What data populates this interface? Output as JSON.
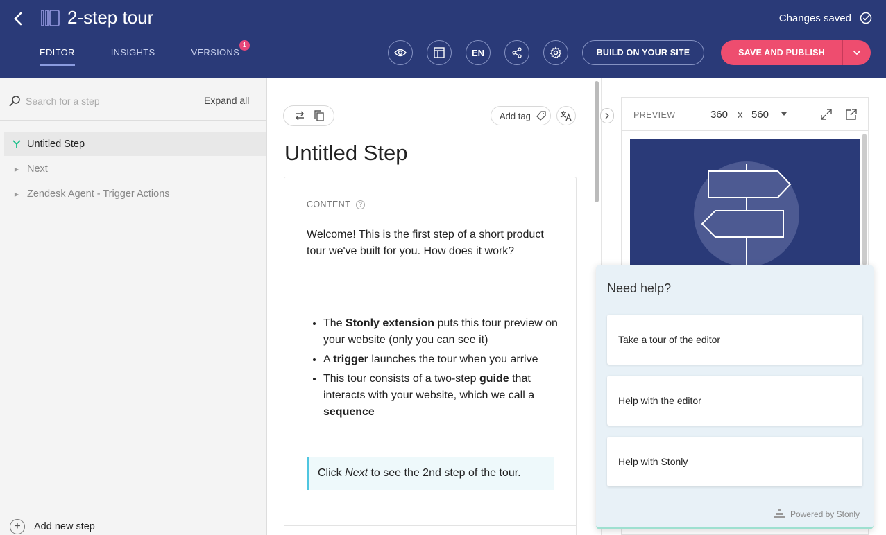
{
  "header": {
    "title": "2-step tour",
    "status": "Changes saved",
    "tabs": [
      {
        "label": "EDITOR"
      },
      {
        "label": "INSIGHTS"
      },
      {
        "label": "VERSIONS",
        "badge": "1"
      }
    ],
    "language": "EN",
    "build_label": "BUILD ON YOUR SITE",
    "publish_label": "SAVE AND PUBLISH"
  },
  "sidebar": {
    "search_placeholder": "Search for a step",
    "expand_all": "Expand all",
    "steps": [
      {
        "label": "Untitled Step"
      },
      {
        "label": "Next"
      },
      {
        "label": "Zendesk Agent - Trigger Actions"
      }
    ],
    "add_step": "Add new step"
  },
  "editor": {
    "add_tag": "Add tag",
    "step_title": "Untitled Step",
    "content_label": "CONTENT",
    "intro": "Welcome! This is the first step of a short product tour we've built for you. How does it work?",
    "bullets": [
      {
        "pre": "The ",
        "bold": "Stonly extension",
        "post": " puts this tour preview on your website (only you can see it)"
      },
      {
        "pre": "A ",
        "bold": "trigger",
        "post": " launches the tour when you arrive"
      },
      {
        "pre": "This tour consists of a two-step ",
        "bold": "guide",
        "post": " that interacts with your website, which we call a ",
        "bold2": "sequence"
      }
    ],
    "callout": {
      "pre": "Click ",
      "italic": "Next",
      "post": " to see the 2nd step of the tour."
    }
  },
  "preview": {
    "label": "PREVIEW",
    "width": "360",
    "sep": "x",
    "height": "560"
  },
  "help": {
    "title": "Need help?",
    "options": [
      {
        "label": "Take a tour of the editor"
      },
      {
        "label": "Help with the editor"
      },
      {
        "label": "Help with Stonly"
      }
    ],
    "powered": "Powered by Stonly"
  },
  "colors": {
    "header_bg": "#2a3a78",
    "publish": "#ee4d6f",
    "badge": "#e6467a",
    "callout_border": "#4fc6e0",
    "active_step_icon": "#1bbf8a"
  },
  "icons": [
    "back-icon",
    "book-icon",
    "check-circle-icon",
    "eye-icon",
    "layout-icon",
    "share-icon",
    "gear-icon",
    "chevron-down-icon",
    "search-icon",
    "branch-icon",
    "caret-right-icon",
    "plus-icon",
    "swap-icon",
    "copy-icon",
    "tag-icon",
    "translate-icon",
    "question-icon",
    "chevron-right-icon",
    "expand-icon",
    "external-link-icon",
    "stonly-logo-icon"
  ]
}
